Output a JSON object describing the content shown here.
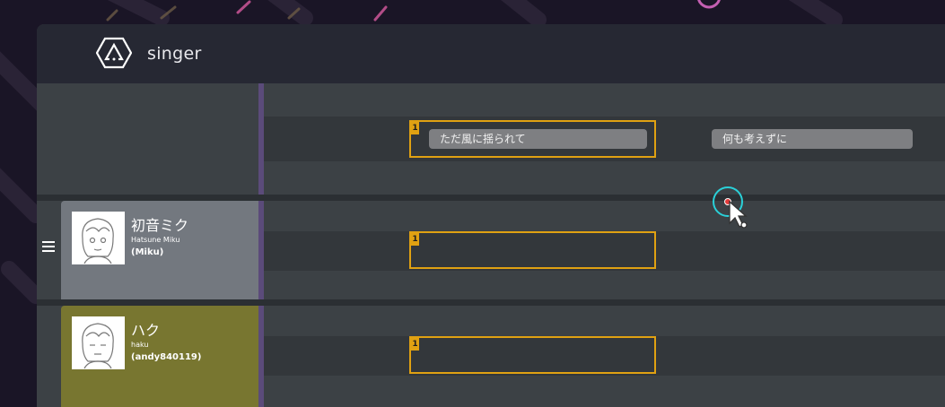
{
  "app": {
    "title": "singer",
    "logo_icon": "hexagon-triangle-logo-icon"
  },
  "colors": {
    "background": "#1a1526",
    "header": "#262833",
    "track_bg": "#3c4145",
    "lane_band": "#33373b",
    "note_border": "#e0a112",
    "lyric_pill": "#7e7f82",
    "divider": "#5b4b7a",
    "miku_card": "#73787f",
    "haku_card": "#787630",
    "cursor_ring": "#2ad0d8"
  },
  "lyrics": {
    "phrases": [
      {
        "number": "1",
        "text": "ただ風に揺られて"
      },
      {
        "text": "何も考えずに"
      }
    ]
  },
  "singers": [
    {
      "name": "初音ミク",
      "romanized": "Hatsune Miku",
      "voice": "(Miku)",
      "note_number": "1"
    },
    {
      "name": "ハク",
      "romanized": "haku",
      "voice": "(andy840119)",
      "note_number": "1"
    }
  ],
  "menu_icon": "hamburger-menu-icon"
}
